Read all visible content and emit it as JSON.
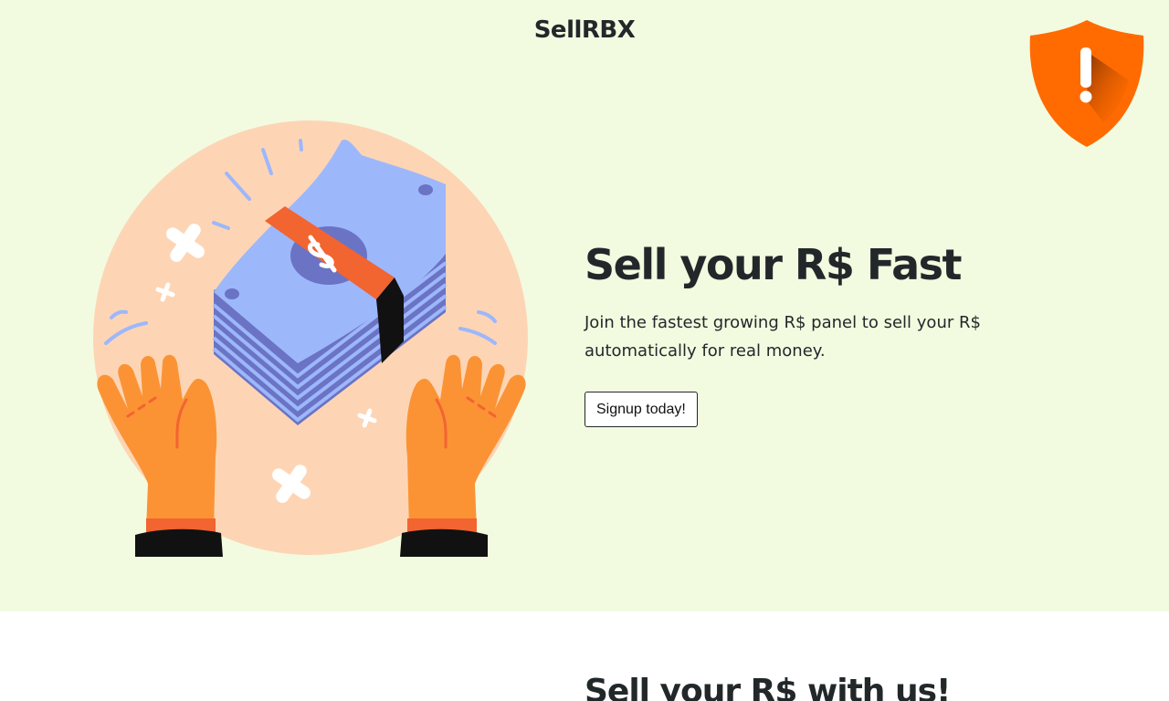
{
  "header": {
    "brand": "SellRBX"
  },
  "hero": {
    "headline": "Sell your R$ Fast",
    "subtext": "Join the fastest growing R$ panel to sell your R$ automatically for real money.",
    "cta_label": "Signup today!",
    "illustration_icon": "money-stack-hands-illustration",
    "alert_icon": "shield-alert-icon"
  },
  "section2": {
    "title": "Sell your R$ with us!"
  },
  "colors": {
    "hero_background": "#f2fbe0",
    "text": "#22282a",
    "shield_orange": "#ff6b00",
    "circle_peach": "#fdd5b5",
    "bill_blue": "#9db7fb",
    "band_orange": "#f26430",
    "hand_orange": "#fb9335"
  }
}
